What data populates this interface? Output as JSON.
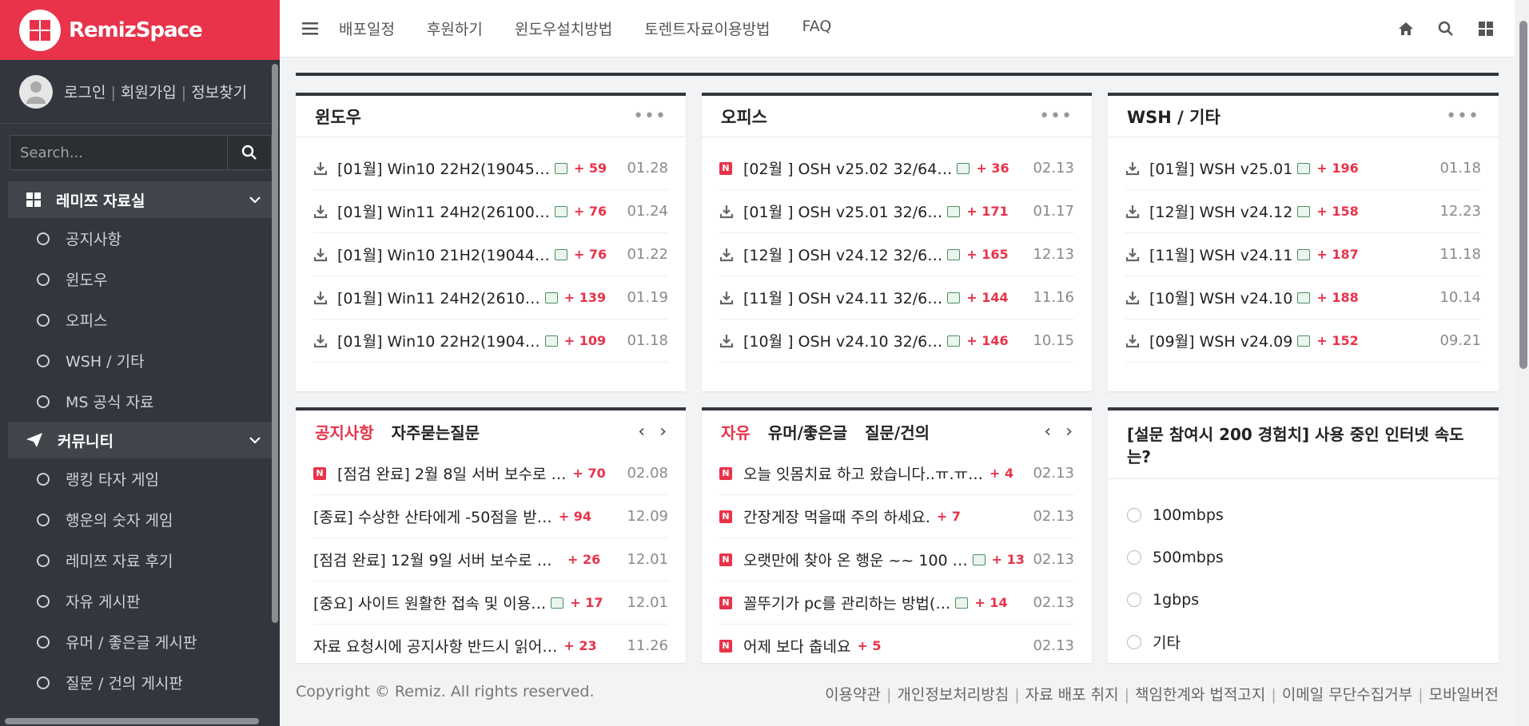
{
  "brand": {
    "name": "RemizSpace"
  },
  "user": {
    "login": "로그인",
    "register": "회원가입",
    "find": "정보찾기"
  },
  "search": {
    "placeholder": "Search..."
  },
  "sidebar": {
    "group1": "레미쯔 자료실",
    "group1_items": [
      "공지사항",
      "윈도우",
      "오피스",
      "WSH / 기타",
      "MS 공식 자료"
    ],
    "group2": "커뮤니티",
    "group2_items": [
      "랭킹 타자 게임",
      "행운의 숫자 게임",
      "레미쯔 자료 후기",
      "자유 게시판",
      "유머 / 좋은글 게시판",
      "질문 / 건의 게시판"
    ]
  },
  "topnav": [
    "배포일정",
    "후원하기",
    "윈도우설치방법",
    "토렌트자료이용방법",
    "FAQ"
  ],
  "widgets": {
    "windows": {
      "title": "윈도우",
      "rows": [
        {
          "t": "[01월] Win10 22H2(19045…",
          "c": "+ 59",
          "d": "01.28"
        },
        {
          "t": "[01월] Win11 24H2(26100…",
          "c": "+ 76",
          "d": "01.24"
        },
        {
          "t": "[01월] Win10 21H2(19044…",
          "c": "+ 76",
          "d": "01.22"
        },
        {
          "t": "[01월] Win11 24H2(2610…",
          "c": "+ 139",
          "d": "01.19"
        },
        {
          "t": "[01월] Win10 22H2(1904…",
          "c": "+ 109",
          "d": "01.18"
        }
      ]
    },
    "office": {
      "title": "오피스",
      "rows": [
        {
          "t": "[02월 ] OSH v25.02 32/64…",
          "c": "+ 36",
          "d": "02.13",
          "n": true
        },
        {
          "t": "[01월 ] OSH v25.01 32/6…",
          "c": "+ 171",
          "d": "01.17"
        },
        {
          "t": "[12월 ] OSH v24.12 32/6…",
          "c": "+ 165",
          "d": "12.13"
        },
        {
          "t": "[11월 ] OSH v24.11 32/6…",
          "c": "+ 144",
          "d": "11.16"
        },
        {
          "t": "[10월 ] OSH v24.10 32/6…",
          "c": "+ 146",
          "d": "10.15"
        }
      ]
    },
    "wsh": {
      "title": "WSH / 기타",
      "rows": [
        {
          "t": "[01월] WSH v25.01",
          "c": "+ 196",
          "d": "01.18"
        },
        {
          "t": "[12월] WSH v24.12",
          "c": "+ 158",
          "d": "12.23"
        },
        {
          "t": "[11월] WSH v24.11",
          "c": "+ 187",
          "d": "11.18"
        },
        {
          "t": "[10월] WSH v24.10",
          "c": "+ 188",
          "d": "10.14"
        },
        {
          "t": "[09월] WSH v24.09",
          "c": "+ 152",
          "d": "09.21"
        }
      ]
    },
    "notice": {
      "tab1": "공지사항",
      "tab2": "자주묻는질문",
      "rows": [
        {
          "t": "[점검 완료] 2월 8일 서버 보수로 …",
          "c": "+ 70",
          "d": "02.08",
          "n": true
        },
        {
          "t": "[종료] 수상한 산타에게 -50점을 받…",
          "c": "+ 94",
          "d": "12.09"
        },
        {
          "t": "[점검 완료] 12월 9일 서버 보수로 사…",
          "c": "+ 26",
          "d": "12.01"
        },
        {
          "t": "[중요] 사이트 원활한 접속 및 이용…",
          "c": "+ 17",
          "d": "12.01",
          "img": true
        },
        {
          "t": "자료 요청시에 공지사항 반드시 읽어…",
          "c": "+ 23",
          "d": "11.26"
        }
      ]
    },
    "free": {
      "tab1": "자유",
      "tab2": "유머/좋은글",
      "tab3": "질문/건의",
      "rows": [
        {
          "t": "오늘 잇몸치료 하고 왔습니다..ㅠ.ㅠ…",
          "c": "+ 4",
          "d": "02.13",
          "n": true
        },
        {
          "t": "간장게장 먹을때 주의 하세요.",
          "c": "+ 7",
          "d": "02.13",
          "n": true
        },
        {
          "t": "오랫만에 찾아 온 행운 ~~ 100 …",
          "c": "+ 13",
          "d": "02.13",
          "n": true,
          "img": true
        },
        {
          "t": "꼴뚜기가 pc를 관리하는 방법(…",
          "c": "+ 14",
          "d": "02.13",
          "n": true,
          "img": true
        },
        {
          "t": "어제 보다 춥네요",
          "c": "+ 5",
          "d": "02.13",
          "n": true
        }
      ]
    },
    "poll": {
      "question": "[설문 참여시 200 경험치] 사용 중인 인터넷 속도는?",
      "options": [
        "100mbps",
        "500mbps",
        "1gbps",
        "기타"
      ]
    }
  },
  "footer": {
    "copyright": "Copyright © Remiz. All rights reserved.",
    "links": [
      "이용약관",
      "개인정보처리방침",
      "자료 배포 취지",
      "책임한계와 법적고지",
      "이메일 무단수집거부",
      "모바일버전"
    ]
  }
}
